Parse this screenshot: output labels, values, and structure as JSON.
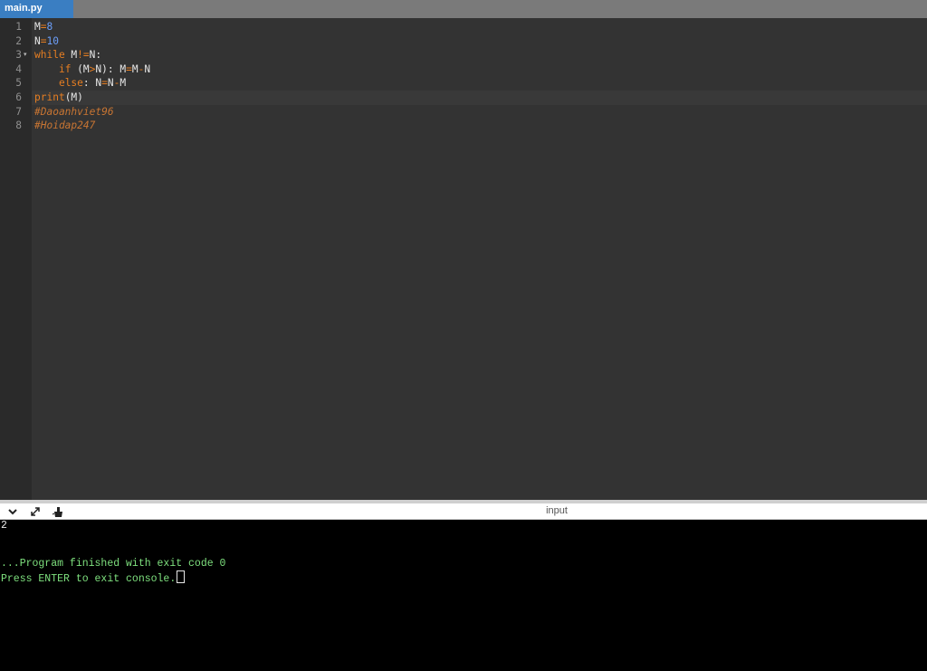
{
  "tab": {
    "filename": "main.py"
  },
  "editor": {
    "lines": [
      {
        "num": "1",
        "tokens": [
          {
            "t": "M",
            "c": "id"
          },
          {
            "t": "=",
            "c": "op"
          },
          {
            "t": "8",
            "c": "num"
          }
        ]
      },
      {
        "num": "2",
        "tokens": [
          {
            "t": "N",
            "c": "id"
          },
          {
            "t": "=",
            "c": "op"
          },
          {
            "t": "10",
            "c": "num"
          }
        ]
      },
      {
        "num": "3",
        "fold": true,
        "tokens": [
          {
            "t": "while",
            "c": "kw"
          },
          {
            "t": " M",
            "c": "id"
          },
          {
            "t": "!=",
            "c": "op"
          },
          {
            "t": "N:",
            "c": "id"
          }
        ]
      },
      {
        "num": "4",
        "tokens": [
          {
            "t": "    ",
            "c": "id"
          },
          {
            "t": "if",
            "c": "kw"
          },
          {
            "t": " (M",
            "c": "id"
          },
          {
            "t": ">",
            "c": "op"
          },
          {
            "t": "N): M",
            "c": "id"
          },
          {
            "t": "=",
            "c": "op"
          },
          {
            "t": "M",
            "c": "id"
          },
          {
            "t": "-",
            "c": "op"
          },
          {
            "t": "N",
            "c": "id"
          }
        ]
      },
      {
        "num": "5",
        "tokens": [
          {
            "t": "    ",
            "c": "id"
          },
          {
            "t": "else",
            "c": "kw"
          },
          {
            "t": ": N",
            "c": "id"
          },
          {
            "t": "=",
            "c": "op"
          },
          {
            "t": "N",
            "c": "id"
          },
          {
            "t": "-",
            "c": "op"
          },
          {
            "t": "M",
            "c": "id"
          }
        ]
      },
      {
        "num": "6",
        "active": true,
        "tokens": [
          {
            "t": "print",
            "c": "kw"
          },
          {
            "t": "(M)",
            "c": "id"
          }
        ]
      },
      {
        "num": "7",
        "tokens": [
          {
            "t": "#Daoanhviet96",
            "c": "comment"
          }
        ]
      },
      {
        "num": "8",
        "tokens": [
          {
            "t": "#Hoidap247",
            "c": "comment"
          }
        ]
      }
    ]
  },
  "console_bar": {
    "label": "input",
    "icons": [
      "chevron-down-icon",
      "expand-icon",
      "clear-console-icon"
    ]
  },
  "console": {
    "output": "2",
    "finished": "...Program finished with exit code 0",
    "prompt": "Press ENTER to exit console."
  },
  "colors": {
    "tab_active": "#3a7ec2",
    "editor_bg": "#333333",
    "keyword": "#e67e22",
    "number": "#6c9ef8",
    "comment": "#c87533",
    "console_green": "#7ee07e"
  }
}
